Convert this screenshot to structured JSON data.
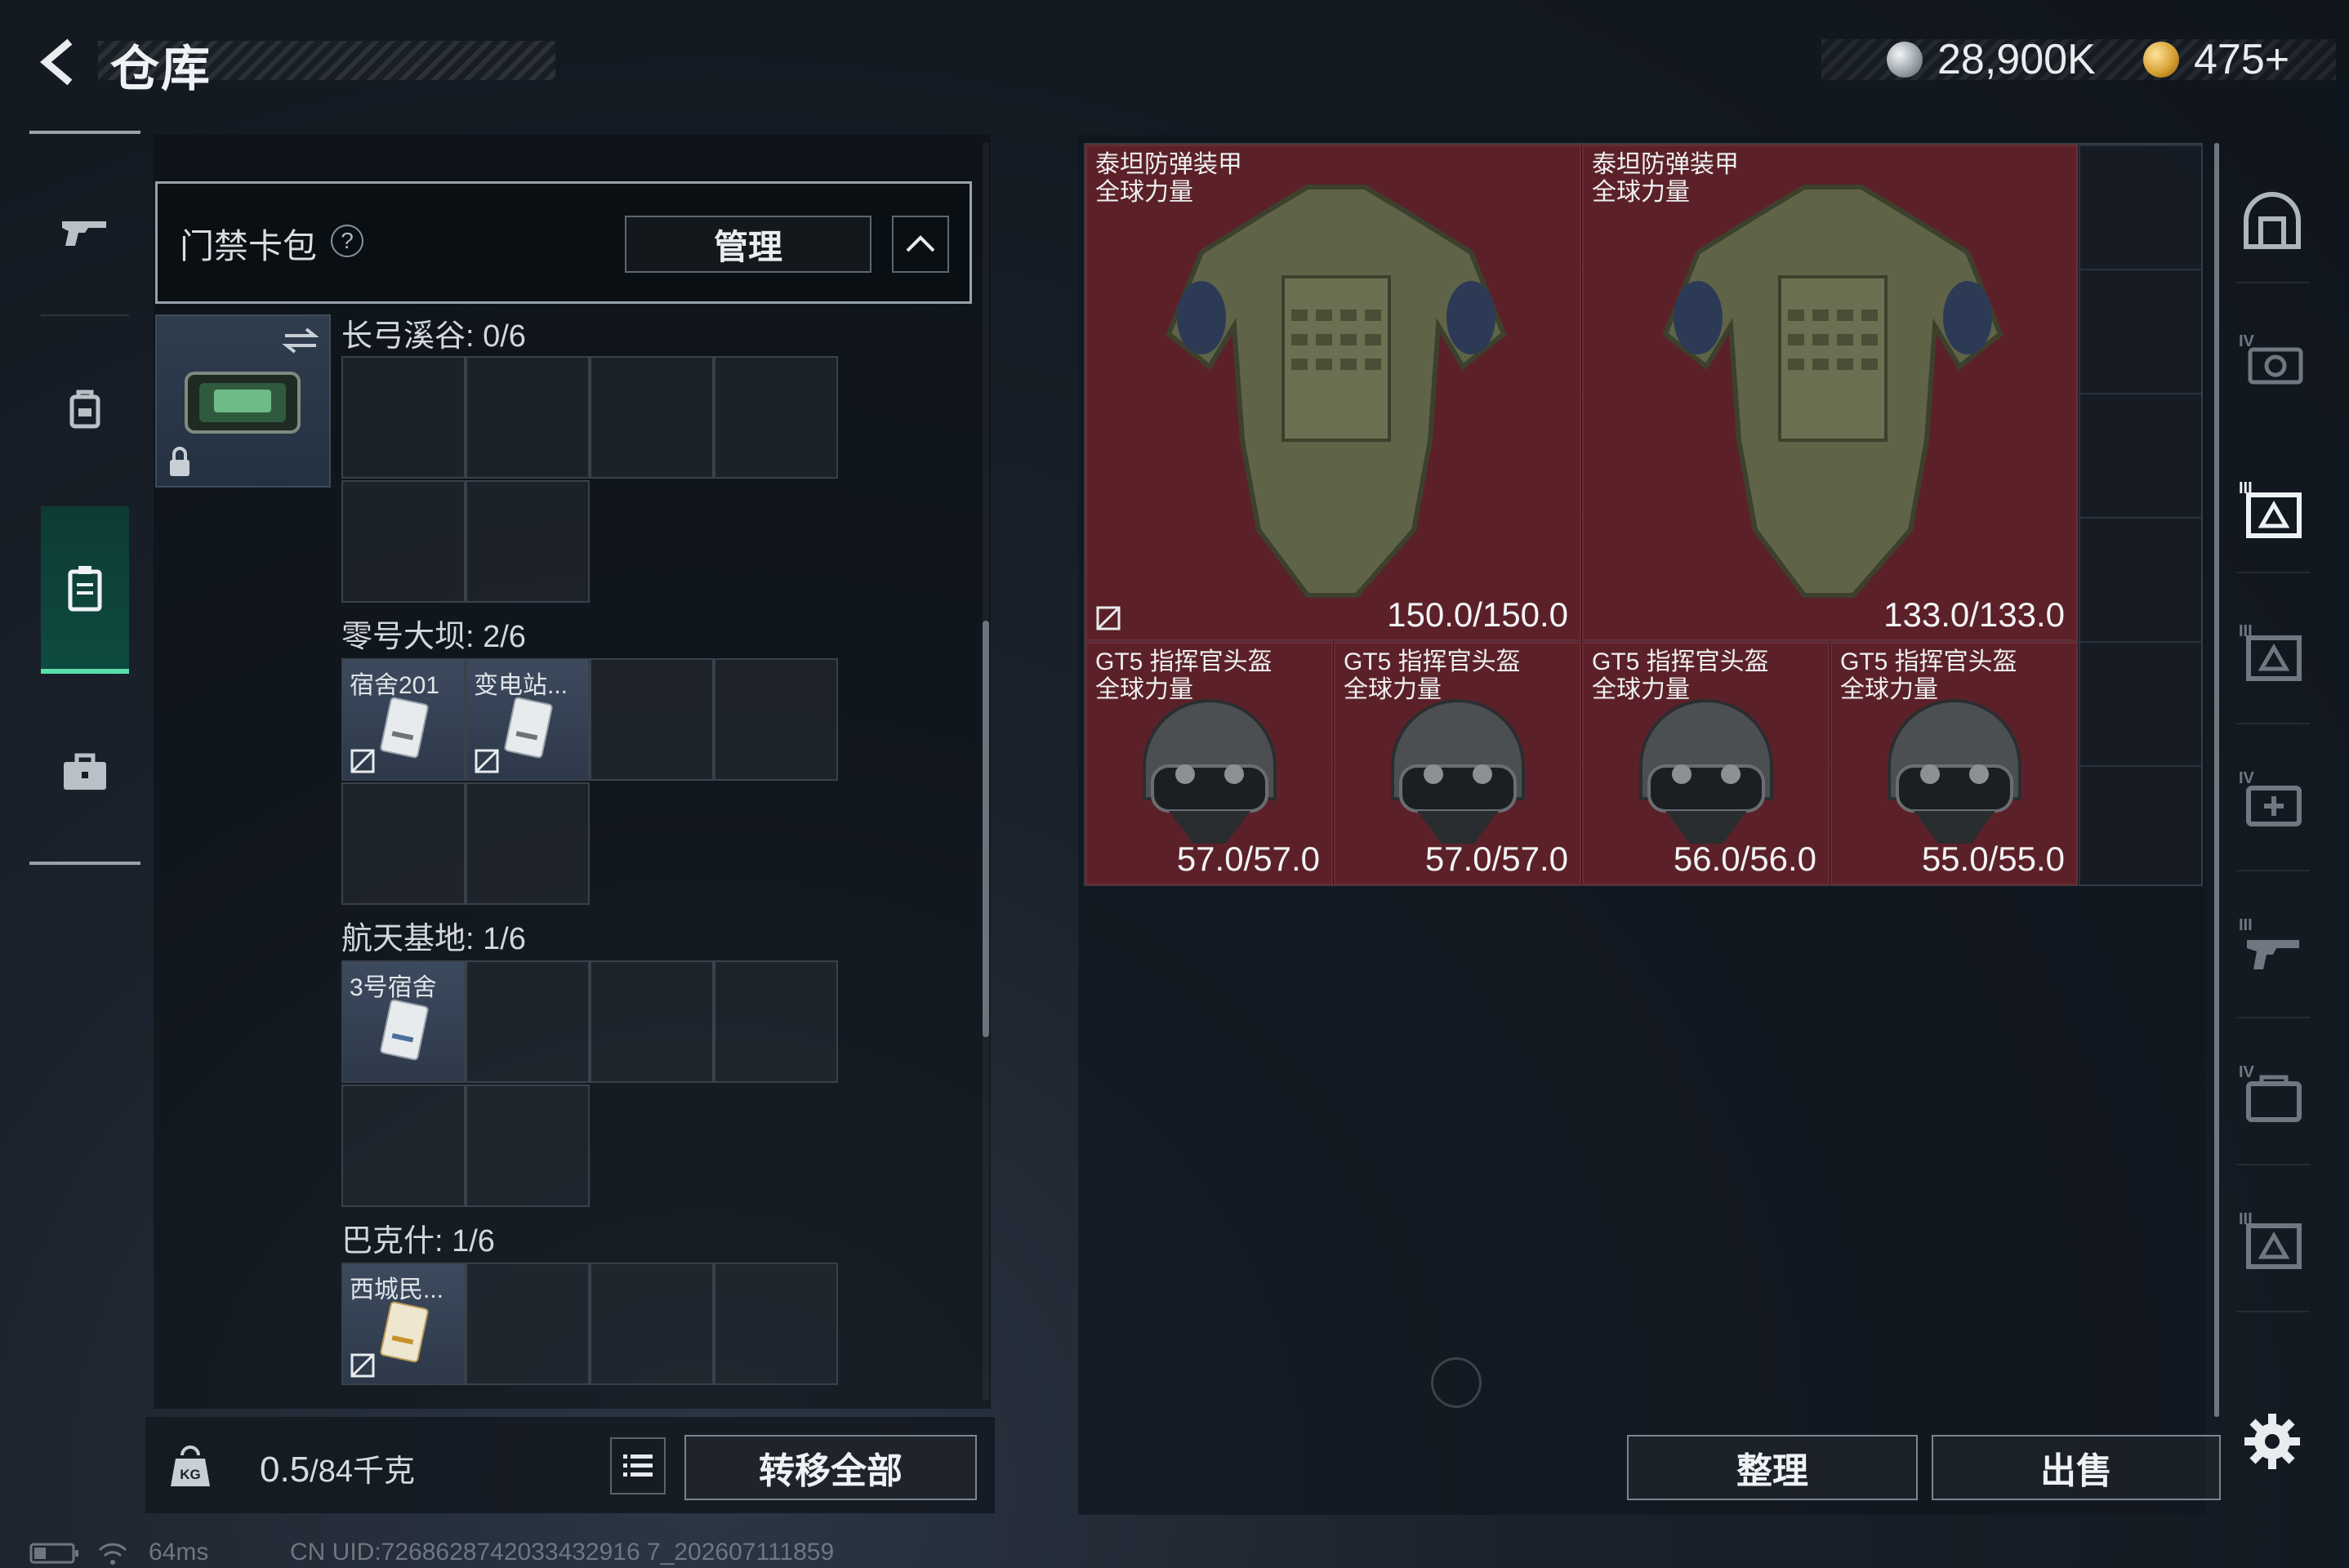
{
  "header": {
    "title": "仓库",
    "back_icon": "back-arrow-icon",
    "currency_silver": "28,900K",
    "currency_gold": "475+"
  },
  "left_rail": {
    "items": [
      {
        "name": "weapons",
        "icon": "gun-icon",
        "active": false
      },
      {
        "name": "backpack",
        "icon": "backpack-icon",
        "active": false
      },
      {
        "name": "cardpack",
        "icon": "card-holder-icon",
        "active": true
      },
      {
        "name": "case",
        "icon": "briefcase-icon",
        "active": false
      }
    ]
  },
  "cardpack": {
    "title": "门禁卡包",
    "help": "?",
    "manage_label": "管理",
    "sections": [
      {
        "label": "长弓溪谷: 0/6",
        "cards": []
      },
      {
        "label": "零号大坝: 2/6",
        "cards": [
          "宿舍201",
          "变电站..."
        ]
      },
      {
        "label": "航天基地: 1/6",
        "cards": [
          "3号宿舍"
        ]
      },
      {
        "label": "巴克什: 1/6",
        "cards": [
          "西城民..."
        ]
      }
    ]
  },
  "footer_left": {
    "weight_value": "0.5",
    "weight_total": "/84千克",
    "transfer_all": "转移全部"
  },
  "items": [
    {
      "name": "泰坦防弹装甲",
      "sub": "全球力量",
      "durability": "150.0/150.0",
      "type": "armor"
    },
    {
      "name": "泰坦防弹装甲",
      "sub": "全球力量",
      "durability": "133.0/133.0",
      "type": "armor"
    },
    {
      "name": "GT5 指挥官头盔",
      "sub": "全球力量",
      "durability": "57.0/57.0",
      "type": "helmet"
    },
    {
      "name": "GT5 指挥官头盔",
      "sub": "全球力量",
      "durability": "57.0/57.0",
      "type": "helmet"
    },
    {
      "name": "GT5 指挥官头盔",
      "sub": "全球力量",
      "durability": "56.0/56.0",
      "type": "helmet"
    },
    {
      "name": "GT5 指挥官头盔",
      "sub": "全球力量",
      "durability": "55.0/55.0",
      "type": "helmet"
    }
  ],
  "footer_right": {
    "sort_label": "整理",
    "sell_label": "出售"
  },
  "right_rail": {
    "items": [
      "house-icon",
      "armor-slot-IV-icon",
      "container-III-icon",
      "container-III-icon",
      "medkit-IV-icon",
      "gun-III-icon",
      "case-IV-icon",
      "container-III-icon"
    ]
  },
  "status": {
    "ping": "64ms",
    "uid": "CN UID:7268628742033432916 7_202607111859"
  },
  "colors": {
    "item_bg": "#5c2128",
    "active_rail": "#58e0a8",
    "panel": "#141a22"
  }
}
